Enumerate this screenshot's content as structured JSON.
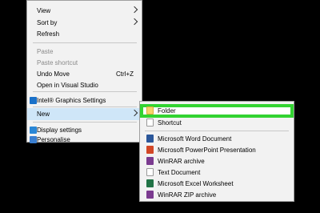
{
  "main_menu": {
    "items": [
      {
        "label": "View",
        "submenu": true
      },
      {
        "label": "Sort by",
        "submenu": true
      },
      {
        "label": "Refresh"
      },
      {
        "label": "Paste",
        "disabled": true
      },
      {
        "label": "Paste shortcut",
        "disabled": true
      },
      {
        "label": "Undo Move",
        "shortcut": "Ctrl+Z"
      },
      {
        "label": "Open in Visual Studio"
      },
      {
        "label": "Intel® Graphics Settings",
        "icon": "intel-icon"
      },
      {
        "label": "New",
        "submenu": true
      },
      {
        "label": "Display settings",
        "icon": "display-icon"
      },
      {
        "label": "Personalise",
        "icon": "personalise-icon"
      }
    ]
  },
  "new_submenu": {
    "items": [
      {
        "label": "Folder",
        "icon": "folder-icon",
        "highlight_color": "#32d331"
      },
      {
        "label": "Shortcut",
        "icon": "shortcut-icon"
      },
      {
        "label": "Microsoft Word Document",
        "icon": "word-icon"
      },
      {
        "label": "Microsoft PowerPoint Presentation",
        "icon": "powerpoint-icon"
      },
      {
        "label": "WinRAR archive",
        "icon": "winrar-icon"
      },
      {
        "label": "Text Document",
        "icon": "text-document-icon"
      },
      {
        "label": "Microsoft Excel Worksheet",
        "icon": "excel-icon"
      },
      {
        "label": "WinRAR ZIP archive",
        "icon": "winrar-zip-icon"
      }
    ]
  }
}
